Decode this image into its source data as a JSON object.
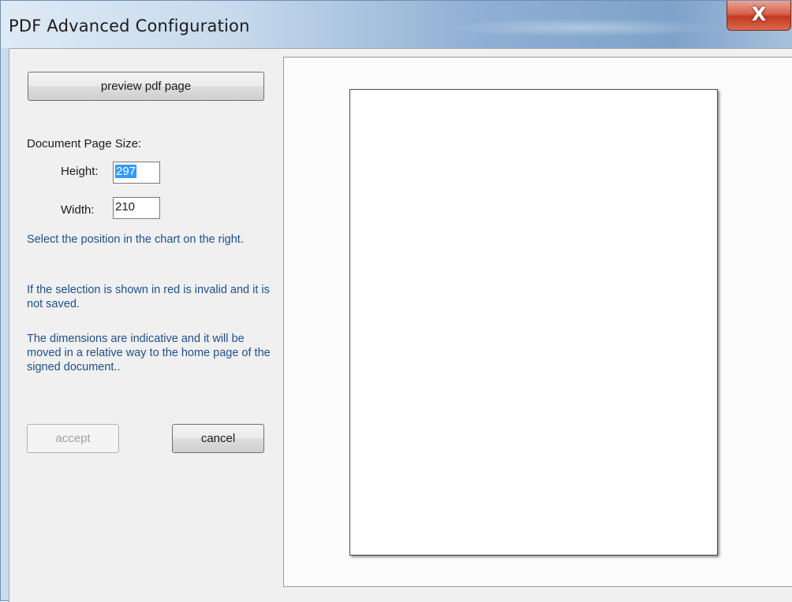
{
  "window": {
    "title": "PDF Advanced Configuration",
    "close_label": "X"
  },
  "left_panel": {
    "preview_button_label": "preview pdf page",
    "page_size_label": "Document Page Size:",
    "height_label": "Height:",
    "height_value": "297",
    "width_label": "Width:",
    "width_value": "210",
    "info_1": "Select the position in the chart on the right.",
    "info_2": "If the selection is shown in red is invalid and it is not saved.",
    "info_3": "The dimensions are indicative and it will be moved in a relative way to the home page of the signed document..",
    "accept_label": "accept",
    "cancel_label": "cancel"
  },
  "icons": {
    "close": "close-icon"
  },
  "colors": {
    "info_text": "#1f4f8f",
    "close_button": "#c23a20",
    "selection": "#3399ff"
  }
}
